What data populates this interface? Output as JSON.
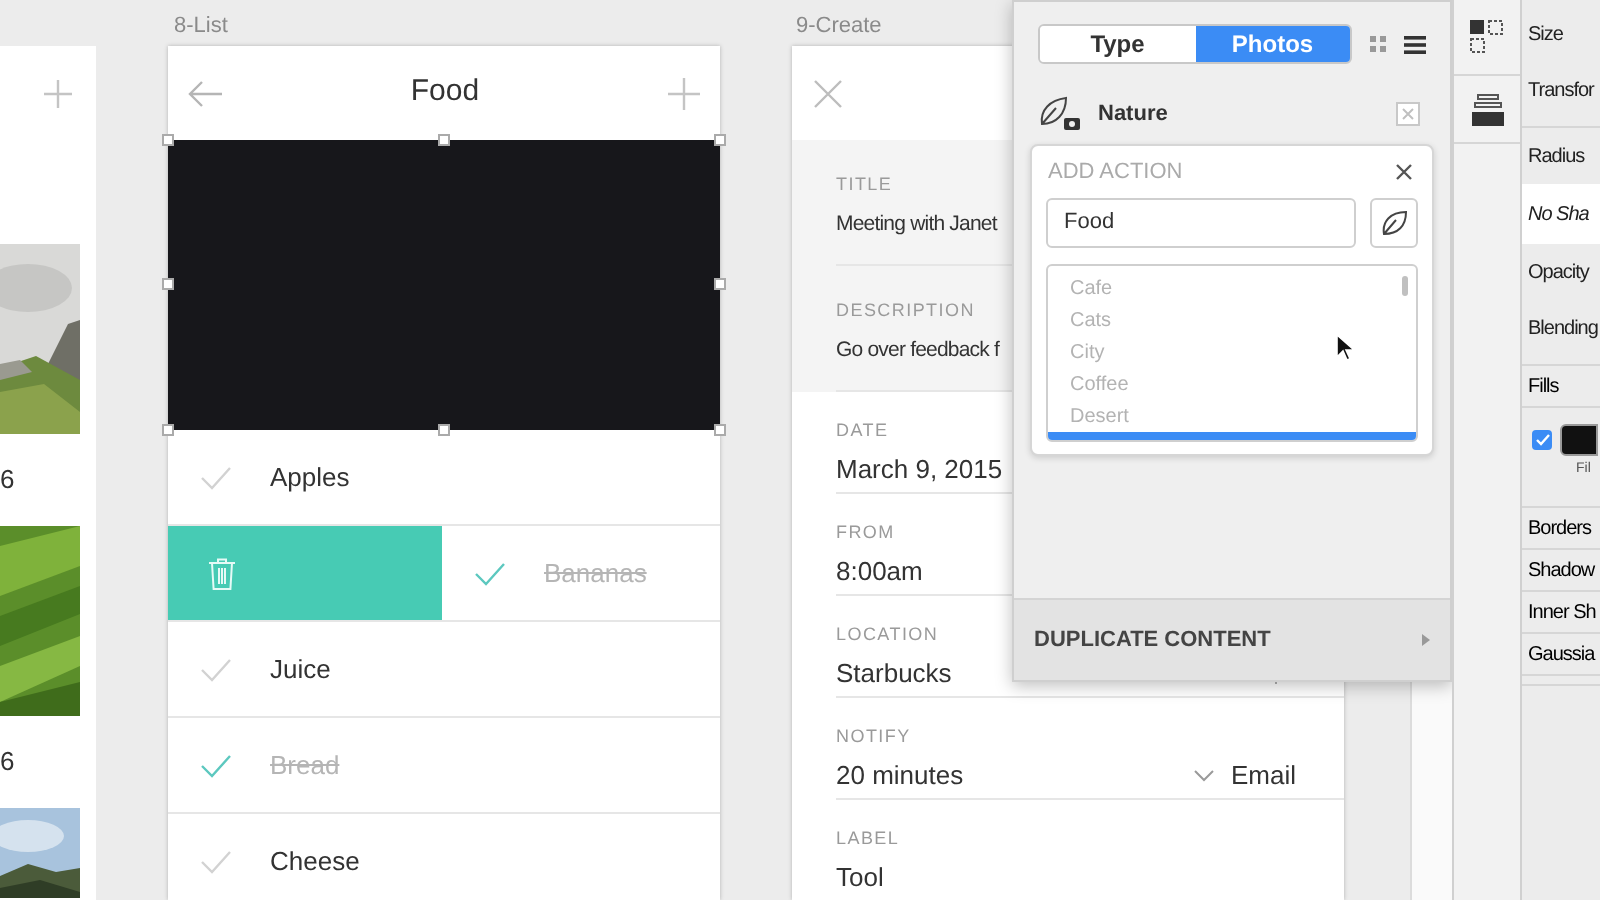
{
  "canvas": {
    "left_artboard": {
      "items": [
        {
          "kind": "picture"
        },
        {
          "kind": "caption",
          "text": "6"
        },
        {
          "kind": "picture"
        },
        {
          "kind": "caption",
          "text": "6"
        },
        {
          "kind": "picture"
        }
      ]
    },
    "list_artboard": {
      "label": "8-List",
      "title": "Food",
      "items": [
        {
          "text": "Apples",
          "checked": false,
          "swiped": false
        },
        {
          "text": "Bananas",
          "checked": true,
          "swiped": true
        },
        {
          "text": "Juice",
          "checked": false,
          "swiped": false
        },
        {
          "text": "Bread",
          "checked": true,
          "swiped": false
        },
        {
          "text": "Cheese",
          "checked": false,
          "swiped": false
        }
      ]
    },
    "create_artboard": {
      "label": "9-Create",
      "sections": [
        {
          "shaded": true,
          "fields": [
            {
              "kind": "text",
              "label": "TITLE",
              "value": "Meeting with Janet"
            },
            {
              "kind": "text",
              "label": "DESCRIPTION",
              "value": "Go over feedback f"
            }
          ]
        },
        {
          "shaded": false,
          "fields": [
            {
              "kind": "text",
              "label": "DATE",
              "value": "March 9, 2015"
            },
            {
              "kind": "text",
              "label": "FROM",
              "value": "8:00am"
            },
            {
              "kind": "location",
              "label": "LOCATION",
              "value": "Starbucks"
            },
            {
              "kind": "select",
              "label": "NOTIFY",
              "value": "20 minutes",
              "extra": "Email"
            },
            {
              "kind": "text",
              "label": "LABEL",
              "value": "Tool"
            }
          ]
        }
      ]
    }
  },
  "popup": {
    "tabs": [
      {
        "label": "Type",
        "selected": false
      },
      {
        "label": "Photos",
        "selected": true
      }
    ],
    "collection": "Nature",
    "add_action": {
      "title": "ADD ACTION",
      "input": {
        "value": "Food"
      },
      "options": [
        "Cafe",
        "Cats",
        "City",
        "Coffee",
        "Desert"
      ]
    },
    "footer": "DUPLICATE CONTENT"
  },
  "inspector": {
    "sections": [
      {
        "rows": [
          {
            "kind": "label",
            "text": "Size"
          },
          {
            "kind": "label",
            "text": "Transfor"
          }
        ]
      },
      {
        "rows": [
          {
            "kind": "label",
            "text": "Radius"
          },
          {
            "kind": "value",
            "text": "No Sha"
          },
          {
            "kind": "label",
            "text": "Opacity"
          },
          {
            "kind": "label",
            "text": "Blending"
          }
        ]
      },
      {
        "rows": [
          {
            "kind": "header",
            "text": "Fills"
          },
          {
            "kind": "fill",
            "checked": true,
            "caption": "Fil"
          }
        ]
      },
      {
        "rows": [
          {
            "kind": "header",
            "text": "Borders"
          },
          {
            "kind": "header",
            "text": "Shadow"
          },
          {
            "kind": "header",
            "text": "Inner Sh"
          },
          {
            "kind": "header",
            "text": "Gaussia"
          }
        ]
      }
    ]
  }
}
